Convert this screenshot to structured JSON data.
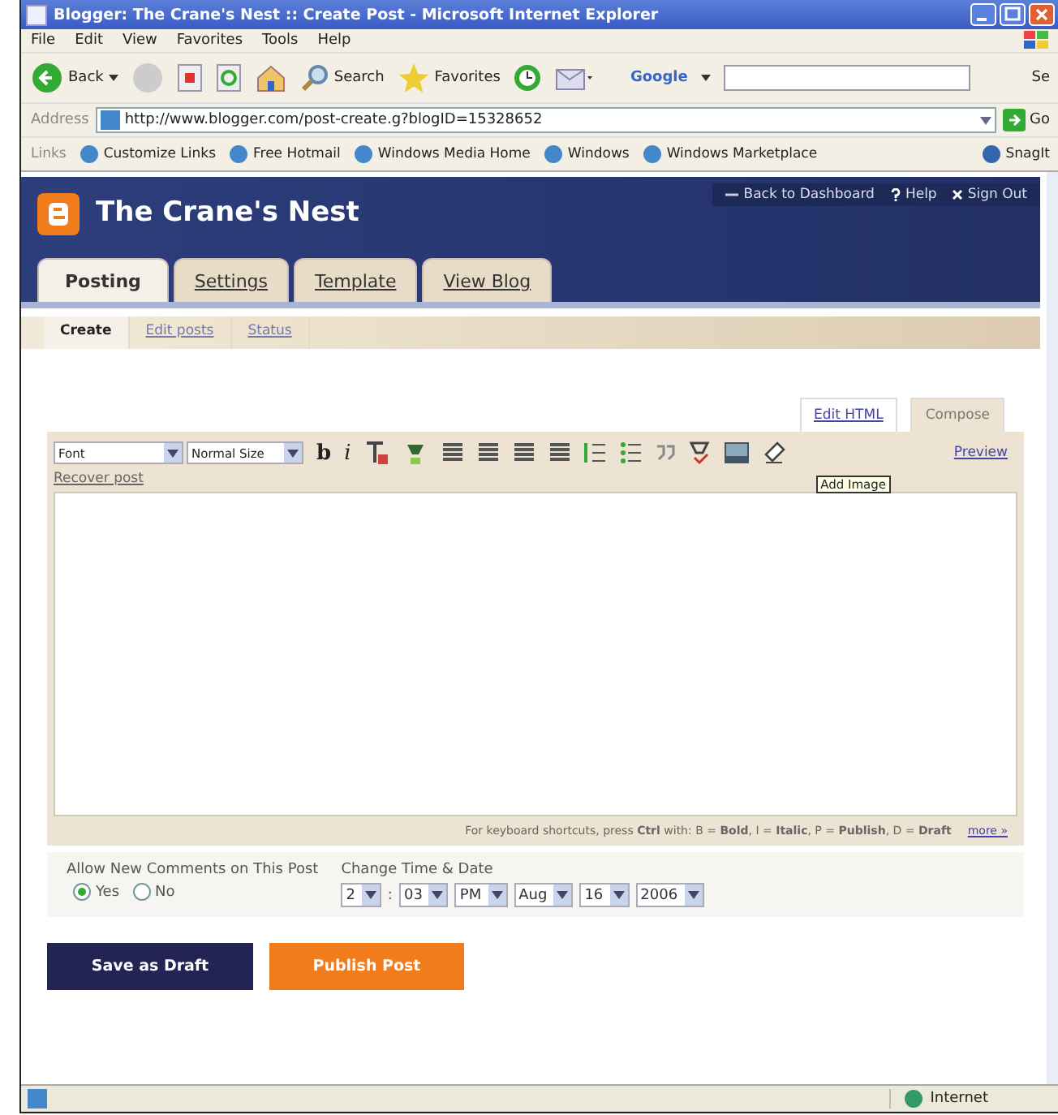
{
  "window": {
    "title": "Blogger: The Crane's Nest :: Create Post - Microsoft Internet Explorer"
  },
  "menu": [
    "File",
    "Edit",
    "View",
    "Favorites",
    "Tools",
    "Help"
  ],
  "toolbar": {
    "back": "Back",
    "search": "Search",
    "favorites": "Favorites",
    "google": "Google",
    "cut_label": "Se"
  },
  "address": {
    "label": "Address",
    "url": "http://www.blogger.com/post-create.g?blogID=15328652",
    "go": "Go"
  },
  "links": {
    "label": "Links",
    "items": [
      "Customize Links",
      "Free Hotmail",
      "Windows Media Home",
      "Windows",
      "Windows Marketplace"
    ],
    "snagit": "SnagIt"
  },
  "blog": {
    "title": "The Crane's Nest",
    "nav": [
      {
        "kind": "back",
        "label": "Back to Dashboard"
      },
      {
        "kind": "help",
        "label": "Help"
      },
      {
        "kind": "signout",
        "label": "Sign Out"
      }
    ],
    "tabs": [
      {
        "label": "Posting",
        "selected": true
      },
      {
        "label": "Settings",
        "selected": false
      },
      {
        "label": "Template",
        "selected": false
      },
      {
        "label": "View Blog",
        "selected": false
      }
    ],
    "subtabs": [
      {
        "label": "Create",
        "selected": true
      },
      {
        "label": "Edit posts",
        "selected": false
      },
      {
        "label": "Status",
        "selected": false
      }
    ]
  },
  "editor": {
    "modes": [
      {
        "label": "Edit HTML",
        "selected": false
      },
      {
        "label": "Compose",
        "selected": true
      }
    ],
    "font": "Font",
    "size": "Normal Size",
    "tools": [
      {
        "kind": "bold",
        "label": "b"
      },
      {
        "kind": "italic",
        "label": "i"
      },
      {
        "kind": "text-color"
      },
      {
        "kind": "highlight"
      },
      {
        "kind": "align-left"
      },
      {
        "kind": "align-center"
      },
      {
        "kind": "align-right"
      },
      {
        "kind": "justify"
      },
      {
        "kind": "numbered-list"
      },
      {
        "kind": "bullet-list"
      },
      {
        "kind": "quote"
      },
      {
        "kind": "spell-check"
      },
      {
        "kind": "image"
      },
      {
        "kind": "eraser"
      }
    ],
    "preview": "Preview",
    "recover": "Recover post",
    "tooltip": "Add Image",
    "hint": "For keyboard shortcuts, press **Ctrl** with: B = **Bold**, I = **Italic**, P = **Publish**, D = **Draft**",
    "more": "more »"
  },
  "options": {
    "comments_label": "Allow New Comments on This Post",
    "radios": [
      {
        "label": "Yes",
        "selected": true
      },
      {
        "label": "No",
        "selected": false
      }
    ],
    "date_label": "Change Time & Date",
    "date": [
      "2",
      ":",
      "03",
      "PM",
      "Aug",
      "16",
      "2006"
    ]
  },
  "buttons": [
    {
      "kind": "draft",
      "label": "Save as Draft"
    },
    {
      "kind": "publish",
      "label": "Publish Post"
    }
  ],
  "status_bar": {
    "zone": "Internet"
  }
}
